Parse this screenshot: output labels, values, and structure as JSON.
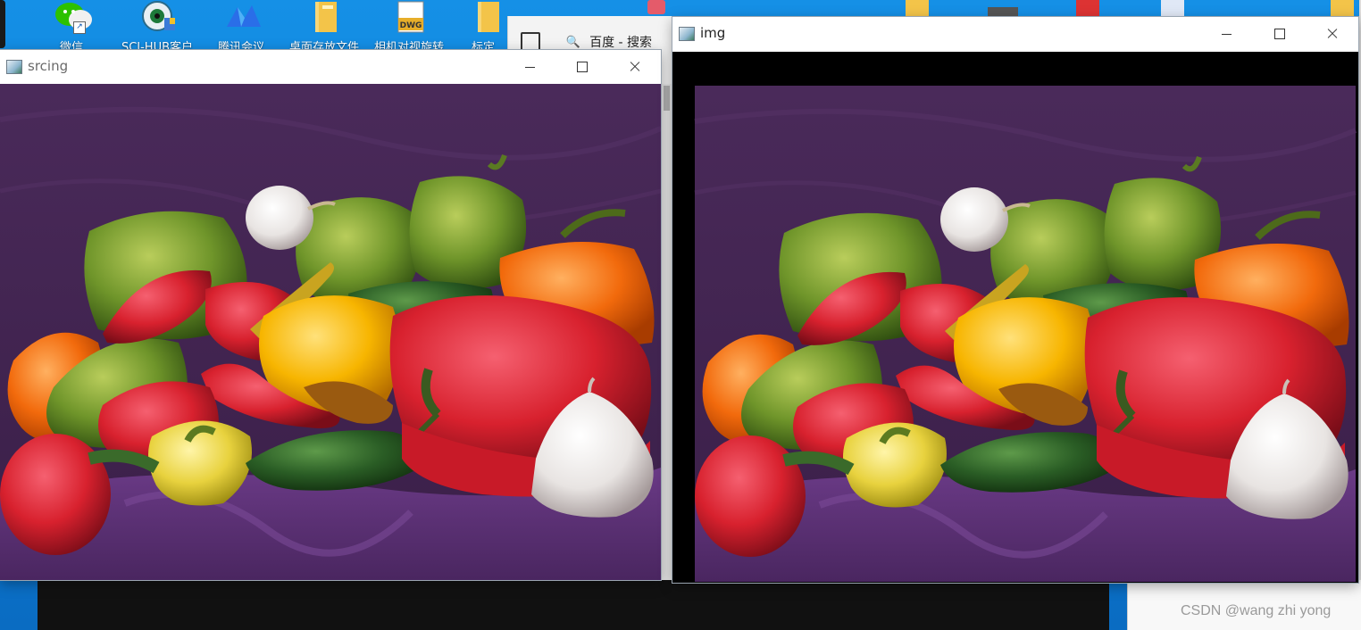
{
  "desktop": {
    "icons": [
      {
        "label": "微信",
        "icon": "wechat-icon",
        "color": "#2dc100"
      },
      {
        "label": "SCI-HUB客户",
        "icon": "scihub-icon",
        "color": "#1d7a3a"
      },
      {
        "label": "腾讯会议",
        "icon": "tencent-meeting-icon",
        "color": "#2a6ee8"
      },
      {
        "label": "桌面存放文件",
        "icon": "folder-icon",
        "color": "#f3c449"
      },
      {
        "label": "相机对视旋转",
        "icon": "dwg-file-icon",
        "color": "#e7ae2a"
      },
      {
        "label": "标定",
        "icon": "folder-icon",
        "color": "#f3c449"
      }
    ],
    "dwg_badge": "DWG"
  },
  "browser": {
    "tab_title": "百度 - 搜索"
  },
  "windows": {
    "src": {
      "title": "srcing"
    },
    "img": {
      "title": "img"
    }
  },
  "image": {
    "subject": "peppers",
    "background_color": "#3e2350",
    "cloth_color": "#5a2f73"
  },
  "watermark": "CSDN @wang zhi yong"
}
